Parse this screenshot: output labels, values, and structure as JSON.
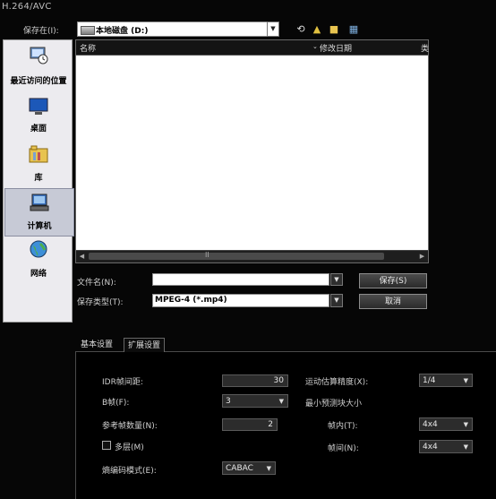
{
  "window": {
    "title": "H.264/AVC"
  },
  "location": {
    "label": "保存在(I):",
    "value": "本地磁盘 (D:)"
  },
  "toolbar": {
    "back_icon": "back-arrow-icon",
    "up_icon": "up-folder-icon",
    "new_folder_icon": "new-folder-icon",
    "views_icon": "views-menu-icon"
  },
  "places": [
    {
      "label": "最近访问的位置",
      "icon": "recent-places-icon"
    },
    {
      "label": "桌面",
      "icon": "desktop-icon"
    },
    {
      "label": "库",
      "icon": "libraries-icon"
    },
    {
      "label": "计算机",
      "icon": "computer-icon",
      "selected": true
    },
    {
      "label": "网络",
      "icon": "network-icon"
    }
  ],
  "file_list": {
    "columns": [
      "名称",
      "修改日期",
      "类"
    ],
    "grip": "II"
  },
  "filename": {
    "label": "文件名(N):",
    "value": ""
  },
  "filetype": {
    "label": "保存类型(T):",
    "value": "MPEG-4 (*.mp4)"
  },
  "buttons": {
    "save": "保存(S)",
    "cancel": "取消"
  },
  "tabs": [
    "基本设置",
    "扩展设置"
  ],
  "settings": {
    "idr_label": "IDR帧间距:",
    "idr_value": "30",
    "bframe_label": "B帧(F):",
    "bframe_value": "3",
    "refs_label": "参考帧数量(N):",
    "refs_value": "2",
    "multilayer_label": "多层(M)",
    "entropy_label": "熵编码模式(E):",
    "entropy_value": "CABAC",
    "motion_label": "运动估算精度(X):",
    "motion_value": "1/4",
    "minblock_label": "最小预测块大小",
    "intra_label": "帧内(T):",
    "intra_value": "4x4",
    "inter_label": "帧间(N):",
    "inter_value": "4x4"
  }
}
